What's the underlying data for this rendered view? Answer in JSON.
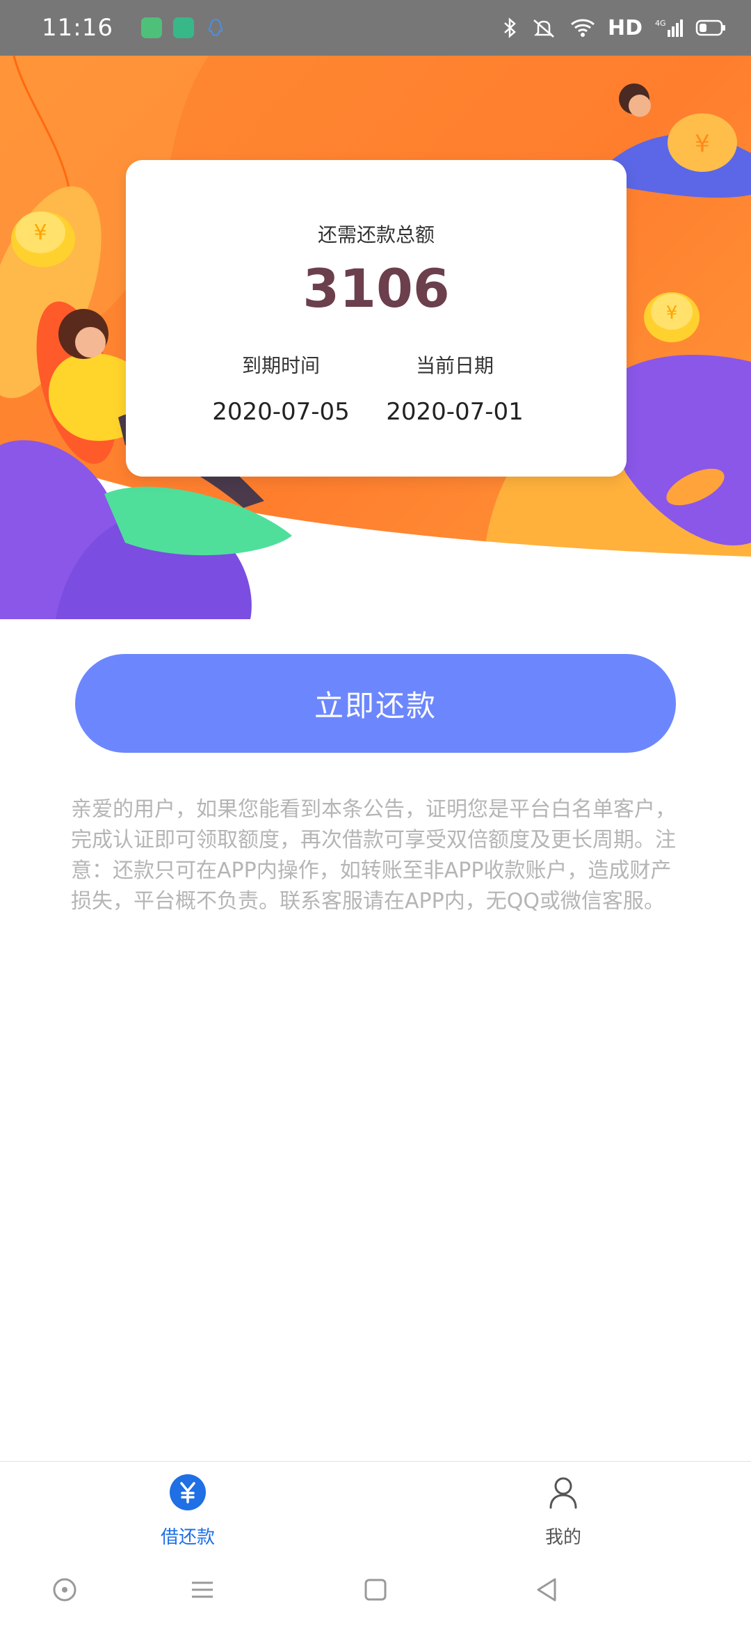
{
  "status_bar": {
    "time": "11:16",
    "network": "HD",
    "signal": "4G",
    "icons": [
      "message-app-icon",
      "shield-app-icon",
      "qq-icon",
      "bluetooth-icon",
      "mute-icon",
      "wifi-icon",
      "signal-icon",
      "battery-icon"
    ]
  },
  "card": {
    "title": "还需还款总额",
    "amount": "3106",
    "due_label": "到期时间",
    "due_value": "2020-07-05",
    "current_label": "当前日期",
    "current_value": "2020-07-01"
  },
  "repay_button_label": "立即还款",
  "notice_text": "亲爱的用户，如果您能看到本条公告，证明您是平台白名单客户，完成认证即可领取额度，再次借款可享受双倍额度及更长周期。注意：还款只可在APP内操作，如转账至非APP收款账户，造成财产损失，平台概不负责。联系客服请在APP内，无QQ或微信客服。",
  "bottom_nav": {
    "items": [
      {
        "label": "借还款",
        "icon": "yuan-icon",
        "active": true
      },
      {
        "label": "我的",
        "icon": "person-icon",
        "active": false
      }
    ]
  },
  "colors": {
    "accent": "#6c87fd",
    "hero_orange": "#ff8a32",
    "amount": "#6b3f4b",
    "active_nav": "#1f6fe5"
  }
}
